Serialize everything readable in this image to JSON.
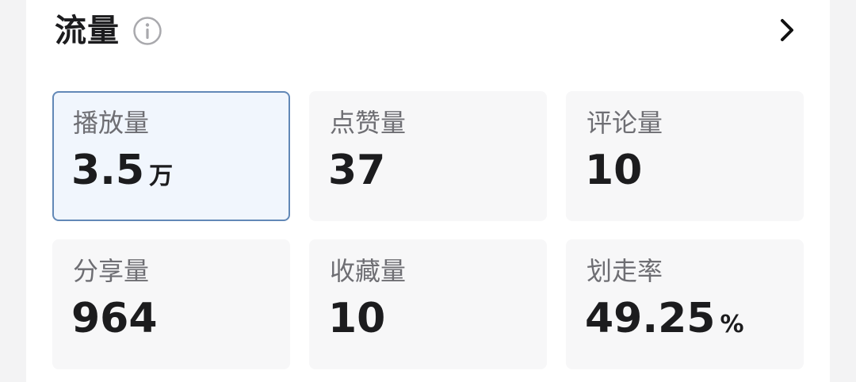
{
  "header": {
    "title": "流量",
    "info_icon": "info-circle-icon",
    "more_icon": "chevron-right-icon"
  },
  "colors": {
    "selected_border": "#6288b7",
    "selected_bg": "#f1f6fd",
    "tile_bg": "#f7f7f8",
    "label": "#6e6e73",
    "value": "#1c1c1e"
  },
  "metrics": [
    {
      "label": "播放量",
      "value": "3.5",
      "unit": "万",
      "selected": true
    },
    {
      "label": "点赞量",
      "value": "37",
      "unit": ""
    },
    {
      "label": "评论量",
      "value": "10",
      "unit": ""
    },
    {
      "label": "分享量",
      "value": "964",
      "unit": ""
    },
    {
      "label": "收藏量",
      "value": "10",
      "unit": ""
    },
    {
      "label": "划走率",
      "value": "49.25",
      "unit": "%"
    }
  ]
}
